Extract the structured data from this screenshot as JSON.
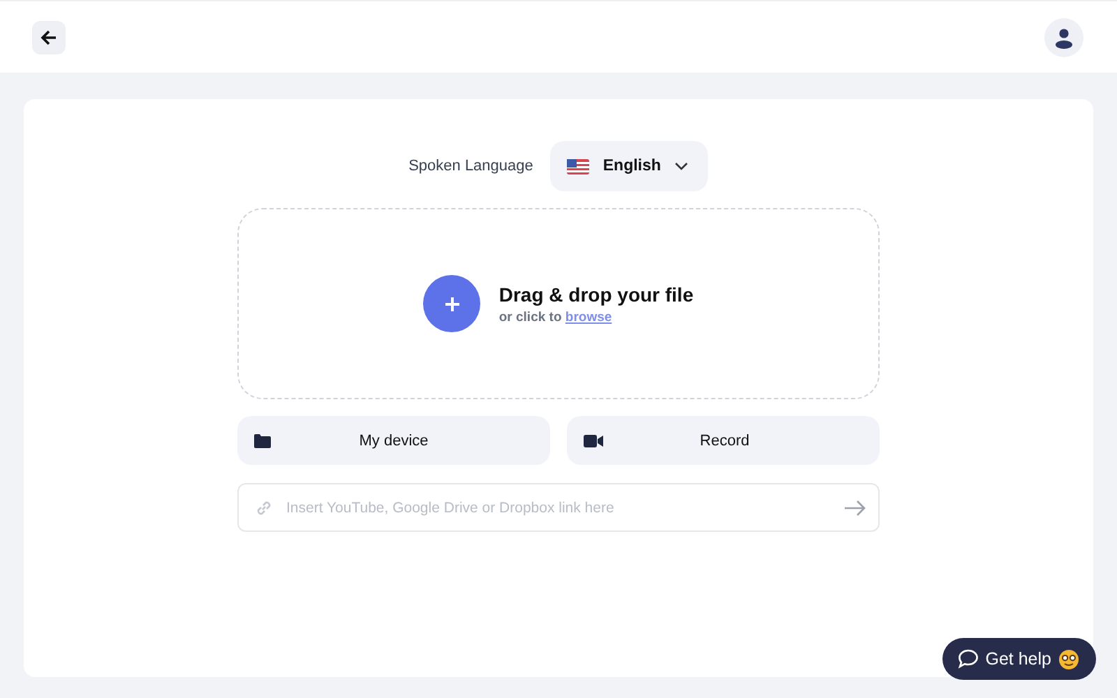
{
  "header": {
    "back_button": {
      "kind": "back"
    },
    "profile_button": {
      "kind": "avatar"
    }
  },
  "language": {
    "label": "Spoken Language",
    "value": "English"
  },
  "dropzone": {
    "title": "Drag & drop your file",
    "subtitle": "or click to",
    "link": "browse"
  },
  "sources": [
    {
      "kind": "folder",
      "label": "My device"
    },
    {
      "kind": "camera",
      "label": "Record"
    }
  ],
  "link_field": {
    "placeholder": "Insert YouTube, Google Drive or Dropbox link here"
  },
  "help_button": {
    "label": "Get help"
  }
}
